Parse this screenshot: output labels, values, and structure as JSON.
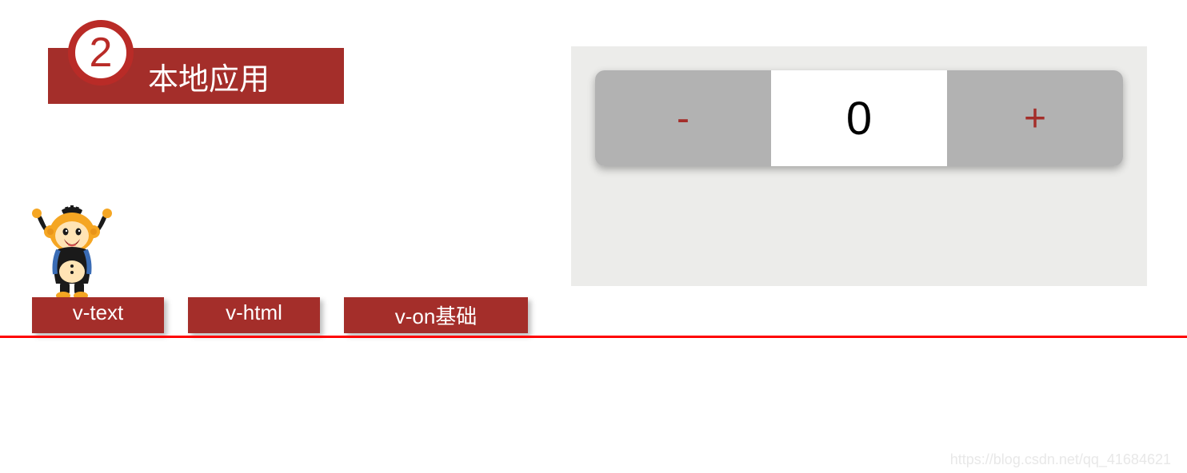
{
  "header": {
    "number": "2",
    "title": "本地应用"
  },
  "counter": {
    "minus_label": "-",
    "value": "0",
    "plus_label": "+"
  },
  "tags": {
    "t1": "v-text",
    "t2": "v-html",
    "t3": "v-on基础"
  },
  "watermark": "https://blog.csdn.net/qq_41684621"
}
